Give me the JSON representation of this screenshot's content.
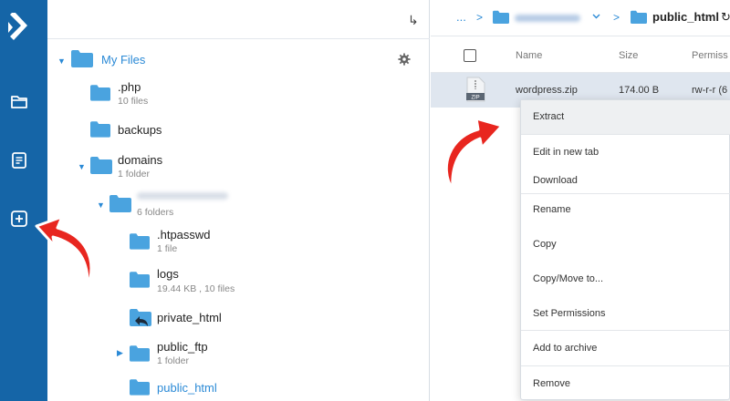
{
  "sidebar": {
    "logo": "logo-icon",
    "items": [
      {
        "icon": "folder-icon"
      },
      {
        "icon": "document-icon"
      },
      {
        "icon": "plus-square-icon"
      }
    ]
  },
  "tree": {
    "collapse_glyph": "↳",
    "root": {
      "label": "My Files"
    },
    "items": [
      {
        "name": ".php",
        "meta": "10 files"
      },
      {
        "name": "backups",
        "meta": ""
      },
      {
        "name": "domains",
        "meta": "1 folder"
      },
      {
        "name": "",
        "meta": "6 folders"
      },
      {
        "name": ".htpasswd",
        "meta": "1 file"
      },
      {
        "name": "logs",
        "meta": "19.44 KB , 10 files"
      },
      {
        "name": "private_html",
        "meta": ""
      },
      {
        "name": "public_ftp",
        "meta": "1 folder"
      },
      {
        "name": "public_html",
        "meta": ""
      }
    ]
  },
  "breadcrumb": {
    "ellipsis": "...",
    "sep": ">",
    "current": "public_html",
    "refresh_glyph": "↻"
  },
  "table": {
    "headers": {
      "name": "Name",
      "size": "Size",
      "perm": "Permiss"
    },
    "rows": [
      {
        "icon_label": "ZIP",
        "name": "wordpress.zip",
        "size": "174.00 B",
        "perm": "rw-r-r (6"
      }
    ]
  },
  "context_menu": {
    "items": [
      "Extract",
      "Edit in new tab",
      "Download",
      "Rename",
      "Copy",
      "Copy/Move to...",
      "Set Permissions",
      "Add to archive",
      "Remove"
    ]
  },
  "colors": {
    "accent": "#1565a7",
    "folder": "#4aa3df",
    "highlight": "#2b8ad6",
    "arrow": "#e8261f"
  }
}
